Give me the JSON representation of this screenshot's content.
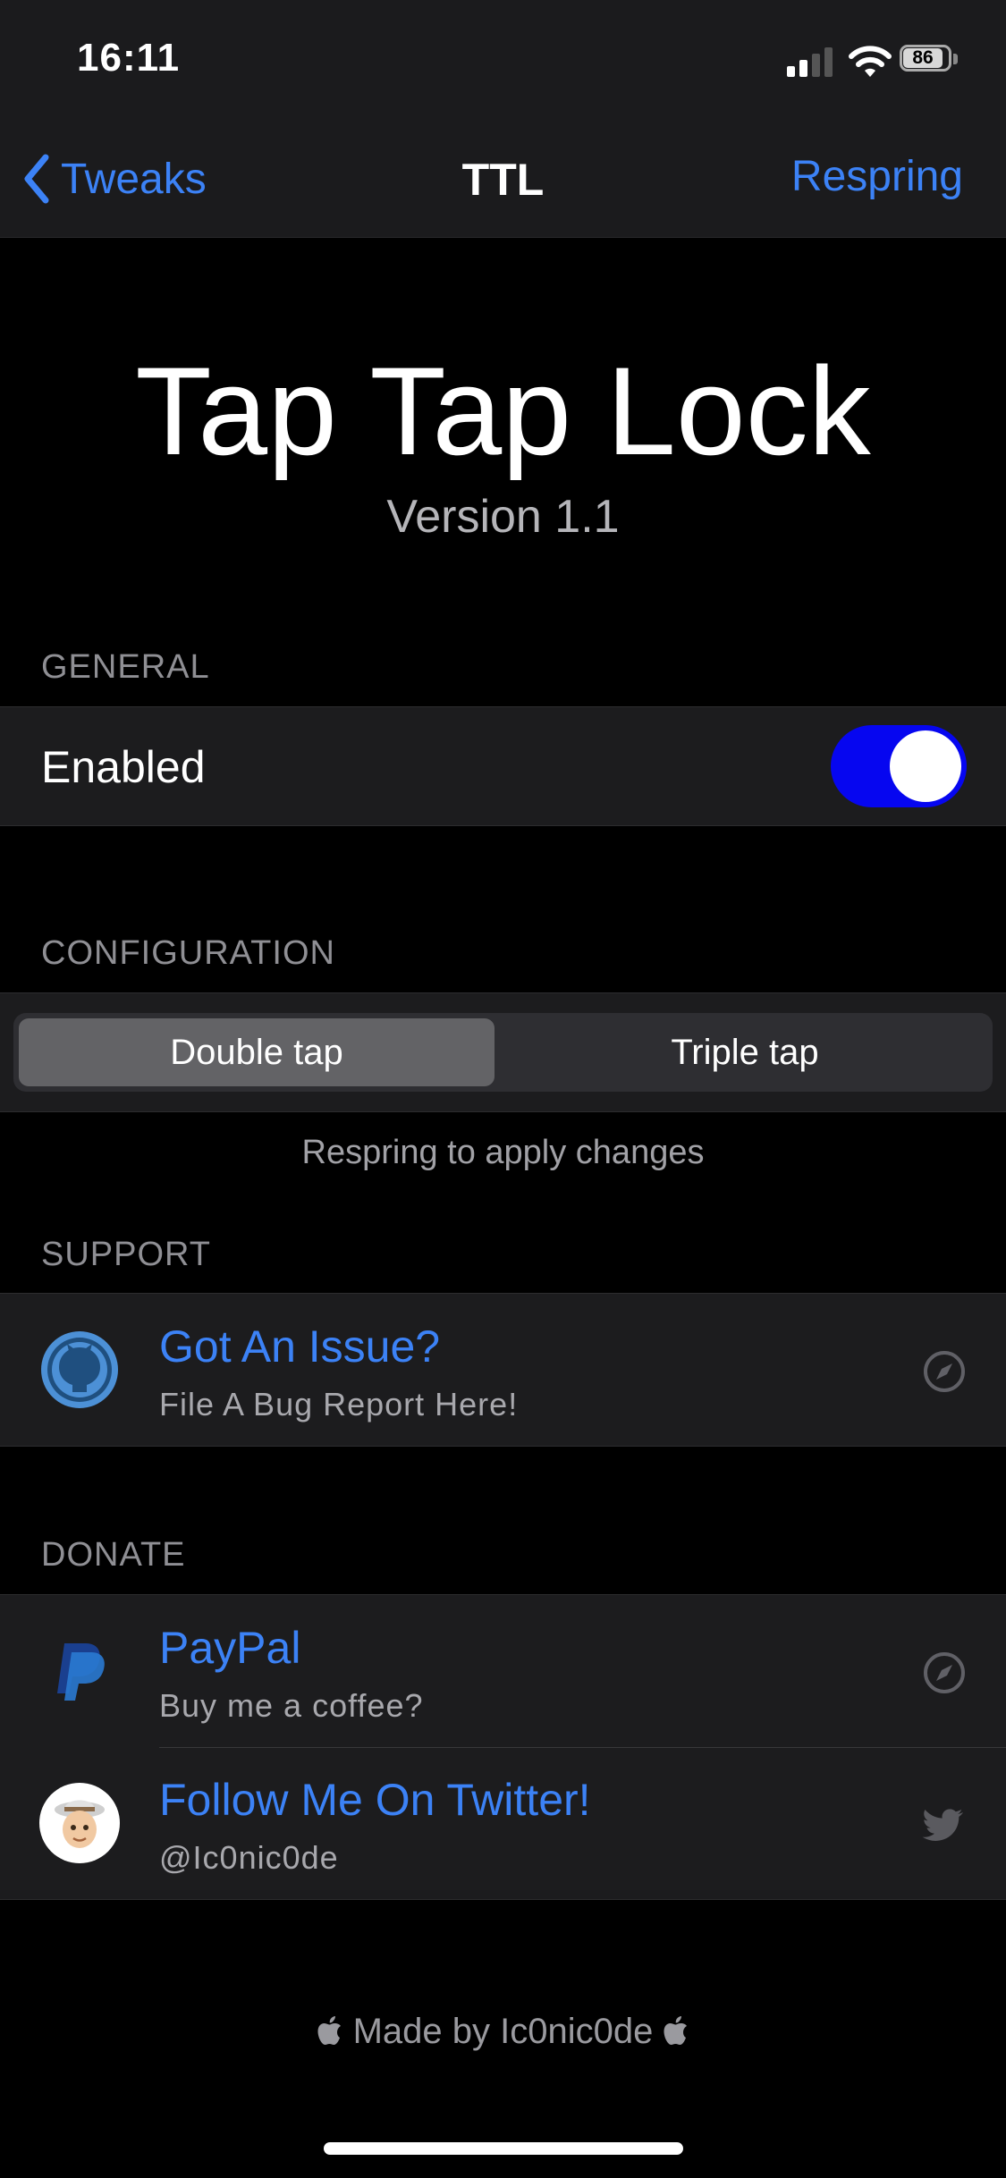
{
  "status_bar": {
    "time": "16:11",
    "battery_level": "86"
  },
  "nav": {
    "back_label": "Tweaks",
    "title": "TTL",
    "action_label": "Respring"
  },
  "hero": {
    "title": "Tap Tap Lock",
    "version": "Version 1.1"
  },
  "general": {
    "header": "GENERAL",
    "enabled_label": "Enabled",
    "enabled": true,
    "toggle_color": "#0606f0"
  },
  "configuration": {
    "header": "CONFIGURATION",
    "options": [
      "Double tap",
      "Triple tap"
    ],
    "selected": "Double tap",
    "footnote": "Respring to apply changes"
  },
  "support": {
    "header": "SUPPORT",
    "items": [
      {
        "title": "Got An Issue?",
        "subtitle": "File A Bug Report Here!",
        "icon": "github-icon",
        "accessory": "safari-compass-icon"
      }
    ]
  },
  "donate": {
    "header": "DONATE",
    "items": [
      {
        "title": "PayPal",
        "subtitle": "Buy me a coffee?",
        "icon": "paypal-icon",
        "accessory": "safari-compass-icon"
      },
      {
        "title": "Follow Me On Twitter!",
        "subtitle": "@Ic0nic0de",
        "icon": "avatar-memoji",
        "accessory": "twitter-bird-icon"
      }
    ]
  },
  "footer": {
    "text": "Made by Ic0nic0de"
  },
  "colors": {
    "accent": "#3c82f6",
    "background": "#000000",
    "cell": "#1c1c1e"
  }
}
